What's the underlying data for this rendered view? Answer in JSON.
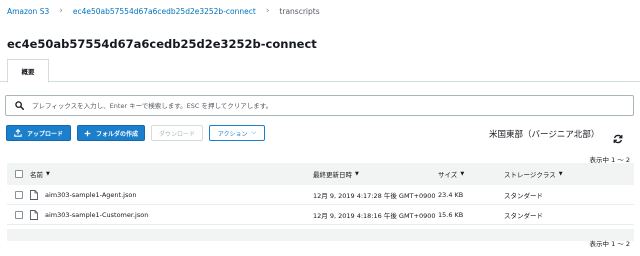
{
  "breadcrumb": {
    "root": "Amazon S3",
    "bucket": "ec4e50ab57554d67a6cedb25d2e3252b-connect",
    "current": "transcripts",
    "separator": "›"
  },
  "page_title": "ec4e50ab57554d67a6cedb25d2e3252b-connect",
  "tabs": [
    {
      "label": "概要"
    }
  ],
  "search": {
    "placeholder": "プレフィックスを入力し、Enter キーで検索します。ESC を押してクリアします。",
    "value": ""
  },
  "toolbar": {
    "upload_label": "アップロード",
    "create_folder_label": "フォルダの作成",
    "download_label": "ダウンロード",
    "actions_label": "アクション",
    "actions_caret": "⌵"
  },
  "region": "米国東部（バージニア北部）",
  "pagination": {
    "top": "表示中 1 ～ 2",
    "bottom": "表示中 1 ～ 2"
  },
  "table": {
    "headers": {
      "name": "名前",
      "modified": "最終更新日時",
      "size": "サイズ",
      "storage_class": "ストレージクラス",
      "sort_caret": "▼"
    },
    "rows": [
      {
        "name": "aim303-sample1-Agent.json",
        "modified": "12月 9, 2019 4:17:28 午後 GMT+0900",
        "size": "23.4 KB",
        "storage_class": "スタンダード"
      },
      {
        "name": "aim303-sample1-Customer.json",
        "modified": "12月 9, 2019 4:18:16 午後 GMT+0900",
        "size": "15.6 KB",
        "storage_class": "スタンダード"
      }
    ]
  },
  "colors": {
    "primary": "#1b7fcc",
    "link": "#0073bb",
    "header_bg": "#f2f3f3",
    "border": "#d5dbdb"
  },
  "icons": {
    "search": "search-icon",
    "upload": "upload-icon",
    "create_folder": "plus-icon",
    "refresh": "refresh-icon",
    "file": "file-icon"
  }
}
